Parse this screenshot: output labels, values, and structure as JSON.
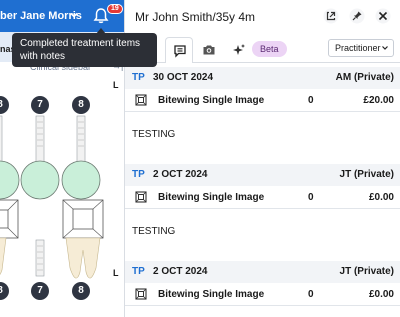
{
  "topbar": {
    "user_name": "ber Jane Morris",
    "notification_count": "19"
  },
  "tooltip": {
    "text": "Completed treatment items with notes"
  },
  "chart": {
    "toolbar_partial": "nas",
    "sidebar_label": "Clinical sidebar",
    "sidebar_toggle": "→|",
    "upper_teeth": [
      "8",
      "7",
      "8"
    ],
    "lower_teeth": [
      "8",
      "7",
      "8"
    ],
    "upper_side": "L",
    "lower_side": "L"
  },
  "patient": {
    "title": "Mr John Smith/35y 4m"
  },
  "tabs": {
    "beta_label": "Beta",
    "role_value": "Practitioner"
  },
  "records": [
    {
      "tp": "TP",
      "date": "30 OCT 2024",
      "provider": "AM (Private)",
      "item": "Bitewing Single Image",
      "qty": "0",
      "price": "£20.00",
      "note": "TESTING"
    },
    {
      "tp": "TP",
      "date": "2 OCT 2024",
      "provider": "JT (Private)",
      "item": "Bitewing Single Image",
      "qty": "0",
      "price": "£0.00",
      "note": "TESTING"
    },
    {
      "tp": "TP",
      "date": "2 OCT 2024",
      "provider": "JT (Private)",
      "item": "Bitewing Single Image",
      "qty": "0",
      "price": "£0.00"
    }
  ],
  "colors": {
    "brand_blue": "#1f6fd1",
    "tooth_fill": "#c9efd9",
    "beta_bg": "#ecd4f5",
    "record_header_bg": "#f2f4f7"
  },
  "icons": [
    "chevron-down-icon",
    "bell-icon",
    "external-link-icon",
    "pin-icon",
    "close-icon",
    "notes-icon",
    "camera-icon",
    "sparkle-icon",
    "xray-icon"
  ]
}
